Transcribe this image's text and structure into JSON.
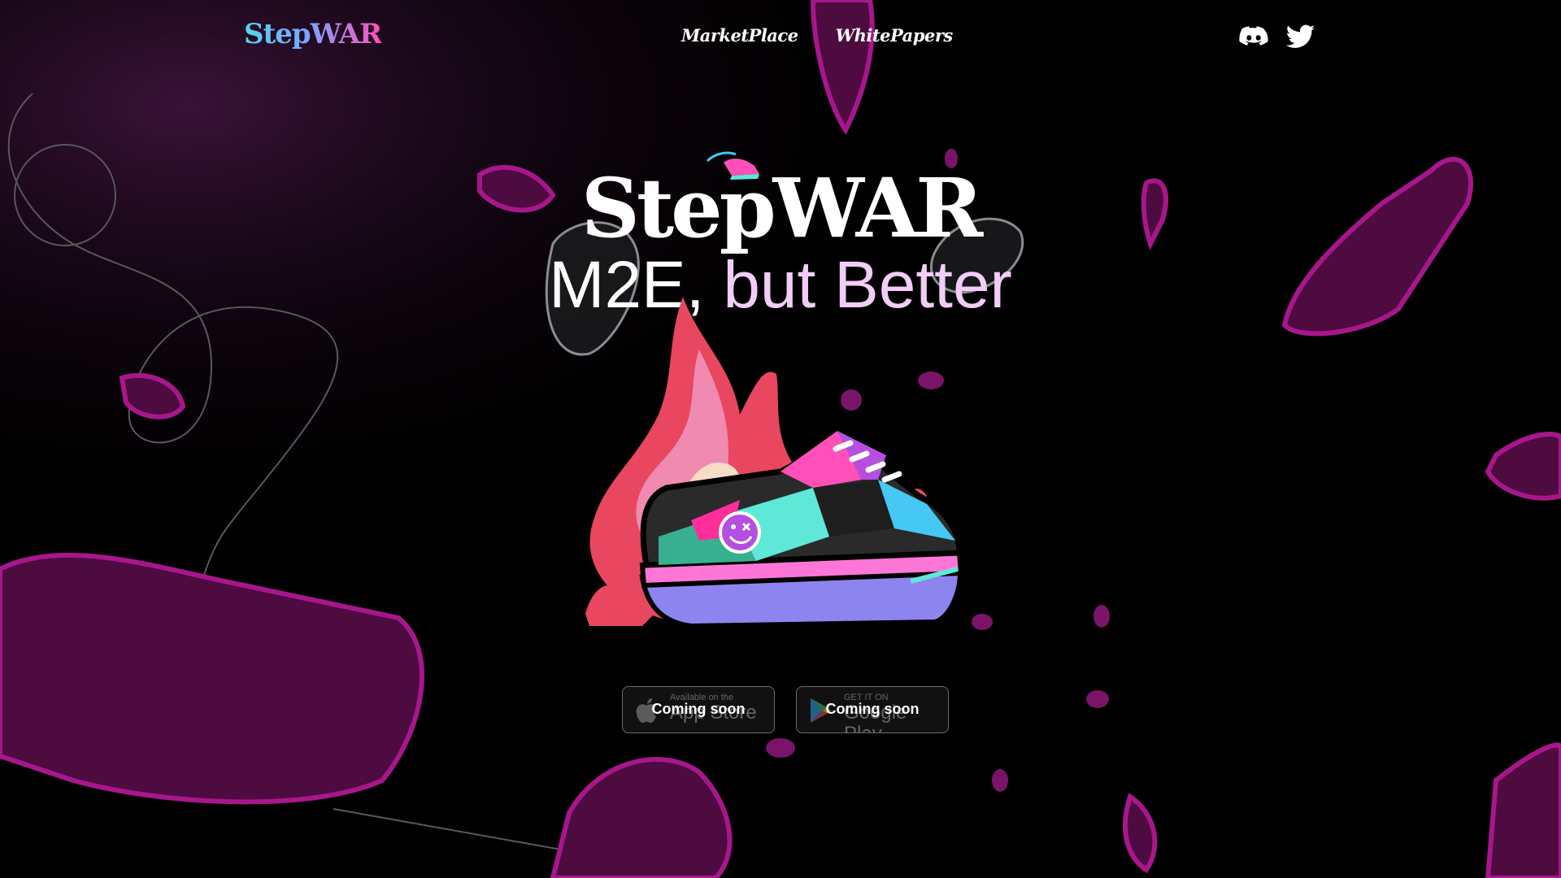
{
  "nav": {
    "logo": "StepWAR",
    "links": [
      {
        "label": "MarketPlace"
      },
      {
        "label": "WhitePapers"
      }
    ],
    "socials": [
      {
        "icon": "discord-icon"
      },
      {
        "icon": "twitter-icon"
      }
    ]
  },
  "hero": {
    "brand": "StepWAR",
    "title_main": "M2E, ",
    "title_accent": "but Better"
  },
  "stores": [
    {
      "name_small": "Available on the",
      "name_big": "App Store",
      "label": "Coming soon",
      "icon": "apple-icon"
    },
    {
      "name_small": "GET IT ON",
      "name_big": "Google Play",
      "label": "Coming soon",
      "icon": "google-play-icon"
    }
  ],
  "colors": {
    "background": "#000000",
    "crystal": "#5a0f4a",
    "crystal_edge": "#c21aa0",
    "accent": "#f2cdf7",
    "flame": "#e8475f",
    "shoe_cyan": "#5ee8d8",
    "shoe_pink": "#ff4fb8",
    "shoe_blue": "#46c8f5"
  }
}
